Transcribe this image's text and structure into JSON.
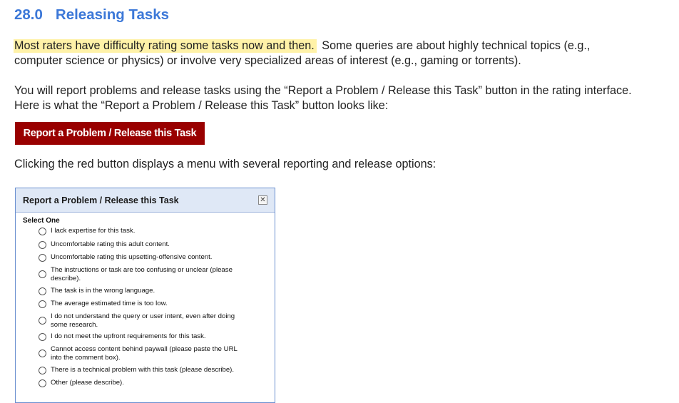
{
  "heading": {
    "number": "28.0",
    "title": "Releasing Tasks"
  },
  "paragraph1": {
    "highlighted": "Most raters have difficulty rating some tasks now and then.",
    "line1_rest": "Some queries are about highly technical topics (e.g.,",
    "line2": "computer science or physics) or involve very specialized areas of interest (e.g., gaming or torrents)."
  },
  "paragraph2": {
    "line1": "You will report problems and release tasks using the “Report a Problem / Release this Task” button in the rating interface.",
    "line2": "Here is what the “Report a Problem / Release this Task” button looks like:"
  },
  "red_button": {
    "label": "Report a Problem / Release this Task",
    "color": "#990000"
  },
  "paragraph3": "Clicking the red button displays a menu with several reporting and release options:",
  "dialog": {
    "title": "Report a Problem / Release this Task",
    "close_glyph": "✕",
    "select_label": "Select One",
    "options": [
      {
        "line1": "I lack expertise for this task."
      },
      {
        "line1": "Uncomfortable rating this adult content."
      },
      {
        "line1": "Uncomfortable rating this upsetting-offensive content."
      },
      {
        "line1": "The instructions or task are too confusing or unclear (please",
        "line2": "describe)."
      },
      {
        "line1": "The task is in the wrong language."
      },
      {
        "line1": "The average estimated time is too low."
      },
      {
        "line1": "I do not understand the query or user intent, even after doing",
        "line2": "some research."
      },
      {
        "line1": "I do not meet the upfront requirements for this task."
      },
      {
        "line1": "Cannot access content behind paywall (please paste the URL",
        "line2": "into the comment box)."
      },
      {
        "line1": "There is a technical problem with this task (please describe)."
      },
      {
        "line1": "Other (please describe)."
      }
    ]
  }
}
